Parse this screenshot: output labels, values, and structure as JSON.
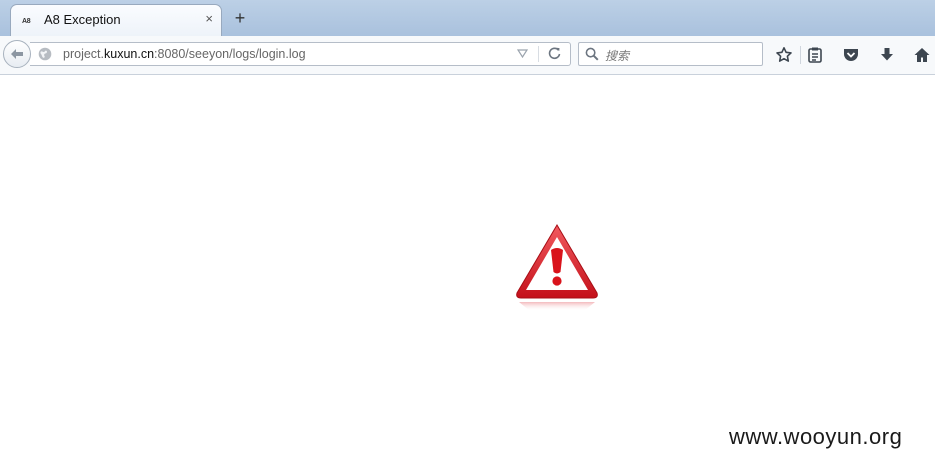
{
  "tab": {
    "favicon_text": "A8",
    "title": "A8 Exception",
    "close_glyph": "×"
  },
  "new_tab_glyph": "+",
  "url": {
    "prefix": "project.",
    "host": "kuxun.cn",
    "suffix": ":8080/seeyon/logs/login.log"
  },
  "search": {
    "placeholder": "搜索"
  },
  "toolbar": {
    "icons": [
      "star-icon",
      "reading-list-icon",
      "pocket-icon",
      "download-icon",
      "home-icon"
    ]
  },
  "content": {
    "icon": "warning-icon"
  },
  "watermark": "www.wooyun.org",
  "colors": {
    "warning_red": "#d9131b",
    "tabstrip": "#b6cbe4"
  }
}
